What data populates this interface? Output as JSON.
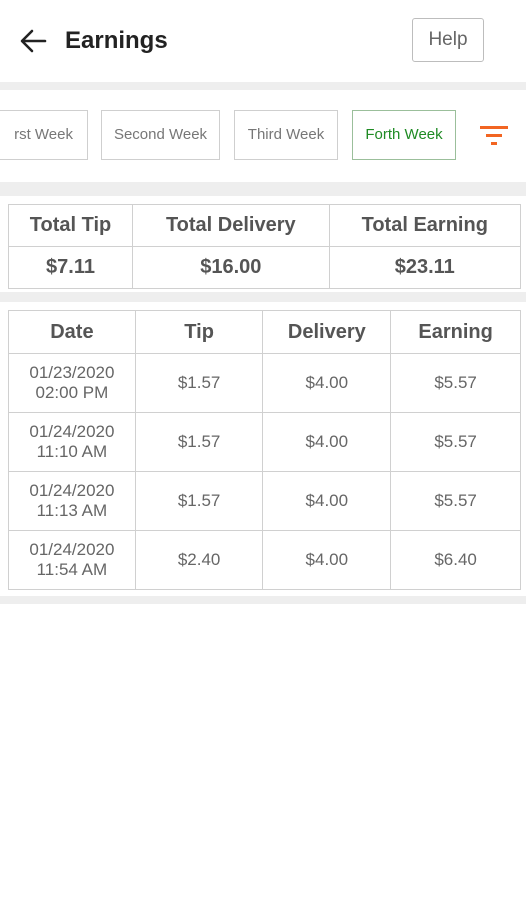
{
  "header": {
    "title": "Earnings",
    "help_label": "Help",
    "back_icon": "arrow-left-icon"
  },
  "weeks": {
    "tabs": [
      {
        "label": "First Week",
        "visible_label": "rst Week"
      },
      {
        "label": "Second Week"
      },
      {
        "label": "Third Week"
      },
      {
        "label": "Forth Week"
      }
    ],
    "active_index": 3,
    "filter_icon": "filter-icon",
    "accent_color": "#f26522",
    "active_color": "#1f8b24"
  },
  "summary": {
    "headers": [
      "Total Tip",
      "Total Delivery",
      "Total Earning"
    ],
    "values": [
      "$7.11",
      "$16.00",
      "$23.11"
    ]
  },
  "table": {
    "headers": [
      "Date",
      "Tip",
      "Delivery",
      "Earning"
    ],
    "rows": [
      {
        "date": "01/23/2020",
        "time": "02:00 PM",
        "tip": "$1.57",
        "delivery": "$4.00",
        "earning": "$5.57"
      },
      {
        "date": "01/24/2020",
        "time": "11:10 AM",
        "tip": "$1.57",
        "delivery": "$4.00",
        "earning": "$5.57"
      },
      {
        "date": "01/24/2020",
        "time": "11:13 AM",
        "tip": "$1.57",
        "delivery": "$4.00",
        "earning": "$5.57"
      },
      {
        "date": "01/24/2020",
        "time": "11:54 AM",
        "tip": "$2.40",
        "delivery": "$4.00",
        "earning": "$6.40"
      }
    ]
  }
}
